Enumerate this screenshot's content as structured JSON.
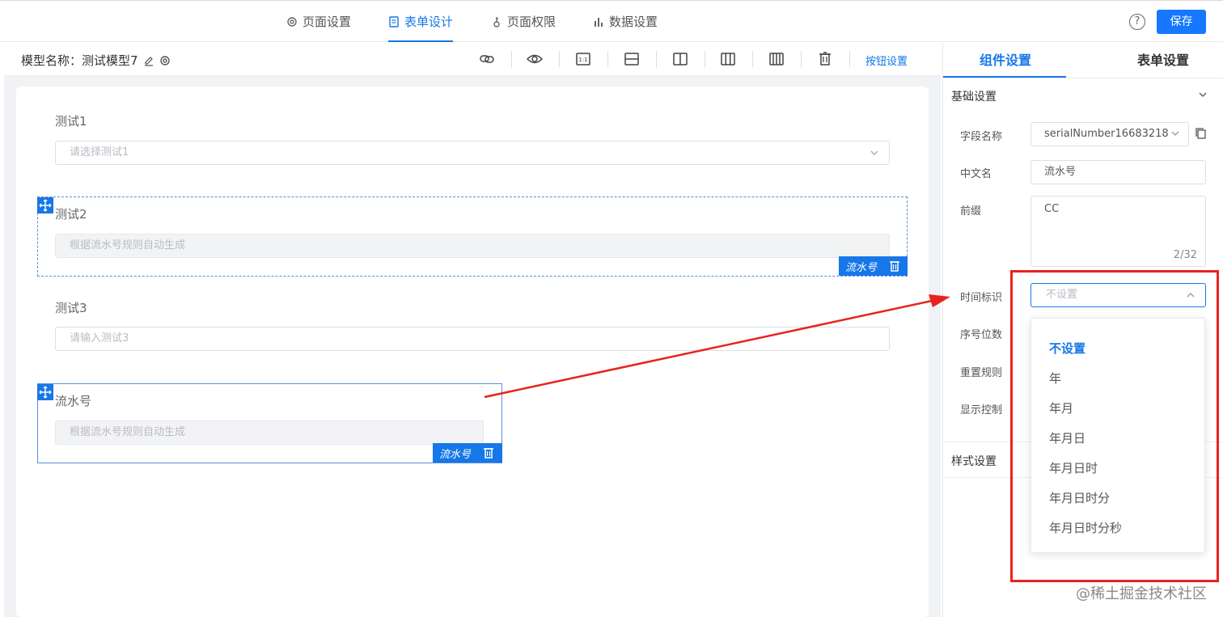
{
  "topnav": {
    "tabs": [
      {
        "label": "页面设置",
        "icon": "gear-icon"
      },
      {
        "label": "表单设计",
        "icon": "document-icon"
      },
      {
        "label": "页面权限",
        "icon": "key-icon"
      },
      {
        "label": "数据设置",
        "icon": "bar-chart-icon"
      }
    ],
    "active_tab": "表单设计",
    "help": "?",
    "save_label": "保存"
  },
  "toolbar": {
    "model_name_label": "模型名称：",
    "model_name": "测试模型7",
    "button_setting_label": "按钮设置",
    "icons": [
      "link-icon",
      "eye-icon",
      "one-to-one-icon",
      "row-layout-icon",
      "two-column-icon",
      "three-column-icon",
      "four-column-icon",
      "trash-icon"
    ]
  },
  "canvas": {
    "fields": [
      {
        "label": "测试1",
        "placeholder": "请选择测试1",
        "type": "select"
      },
      {
        "label": "测试2",
        "placeholder": "根据流水号规则自动生成",
        "type": "serial"
      },
      {
        "label": "测试3",
        "placeholder": "请输入测试3",
        "type": "input"
      },
      {
        "label": "流水号",
        "placeholder": "根据流水号规则自动生成",
        "type": "serial"
      }
    ],
    "tag_label": "流水号"
  },
  "right_panel": {
    "tabs": [
      "组件设置",
      "表单设置"
    ],
    "active_tab": "组件设置",
    "basic_section": "基础设置",
    "style_section": "样式设置",
    "form": {
      "field_name_label": "字段名称",
      "field_name_value": "serialNumber16683218",
      "cn_name_label": "中文名",
      "cn_name_value": "流水号",
      "prefix_label": "前缀",
      "prefix_value": "CC",
      "prefix_counter": "2/32",
      "time_label": "时间标识",
      "time_placeholder": "不设置",
      "seq_label": "序号位数",
      "reset_label": "重置规则",
      "display_label": "显示控制"
    },
    "dropdown_options": [
      "不设置",
      "年",
      "年月",
      "年月日",
      "年月日时",
      "年月日时分",
      "年月日时分秒"
    ],
    "dropdown_selected": "不设置"
  },
  "watermark": "@稀土掘金技术社区",
  "colors": {
    "accent": "#1677e8",
    "annotation": "#e8231d"
  }
}
